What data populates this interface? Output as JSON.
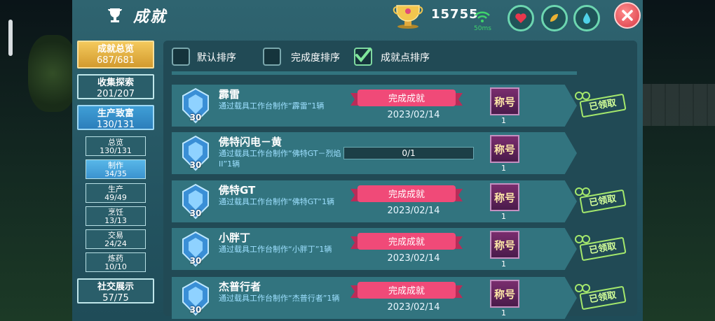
{
  "header": {
    "title": "成就",
    "score": "15755",
    "ping": "50ms"
  },
  "sidebar": {
    "main": [
      {
        "label": "成就总览",
        "count": "687/681"
      },
      {
        "label": "收集探索",
        "count": "201/207"
      },
      {
        "label": "生产致富",
        "count": "130/131"
      }
    ],
    "sub": [
      {
        "label": "总览",
        "count": "130/131"
      },
      {
        "label": "制作",
        "count": "34/35"
      },
      {
        "label": "生产",
        "count": "49/49"
      },
      {
        "label": "烹饪",
        "count": "13/13"
      },
      {
        "label": "交易",
        "count": "24/24"
      },
      {
        "label": "炼药",
        "count": "10/10"
      }
    ],
    "social": {
      "label": "社交展示",
      "count": "57/75"
    }
  },
  "sort": {
    "default": "默认排序",
    "completion": "完成度排序",
    "points": "成就点排序"
  },
  "rows": [
    {
      "name": "霹雷",
      "desc": "通过载具工作台制作“霹雷”1辆",
      "points": "30",
      "status": "完成成就",
      "date": "2023/02/14",
      "title_label": "称号",
      "title_count": "1",
      "claimed": "已领取"
    },
    {
      "name": "佛特闪电－黄",
      "desc": "通过载具工作台制作“佛特GT－烈焰II”1辆",
      "points": "30",
      "progress": "0/1",
      "title_label": "称号",
      "title_count": "1"
    },
    {
      "name": "佛特GT",
      "desc": "通过载具工作台制作“佛特GT”1辆",
      "points": "30",
      "status": "完成成就",
      "date": "2023/02/14",
      "title_label": "称号",
      "title_count": "1",
      "claimed": "已领取"
    },
    {
      "name": "小胖丁",
      "desc": "通过载具工作台制作“小胖丁”1辆",
      "points": "30",
      "status": "完成成就",
      "date": "2023/02/14",
      "title_label": "称号",
      "title_count": "1",
      "claimed": "已领取"
    },
    {
      "name": "杰普行者",
      "desc": "通过载具工作台制作“杰普行者”1辆",
      "points": "30",
      "status": "完成成就",
      "date": "2023/02/14",
      "title_label": "称号",
      "title_count": "1",
      "claimed": "已领取"
    }
  ],
  "colors": {
    "accent": "#f04a78",
    "panel": "#2f6470",
    "claimed": "#a4e86c"
  }
}
